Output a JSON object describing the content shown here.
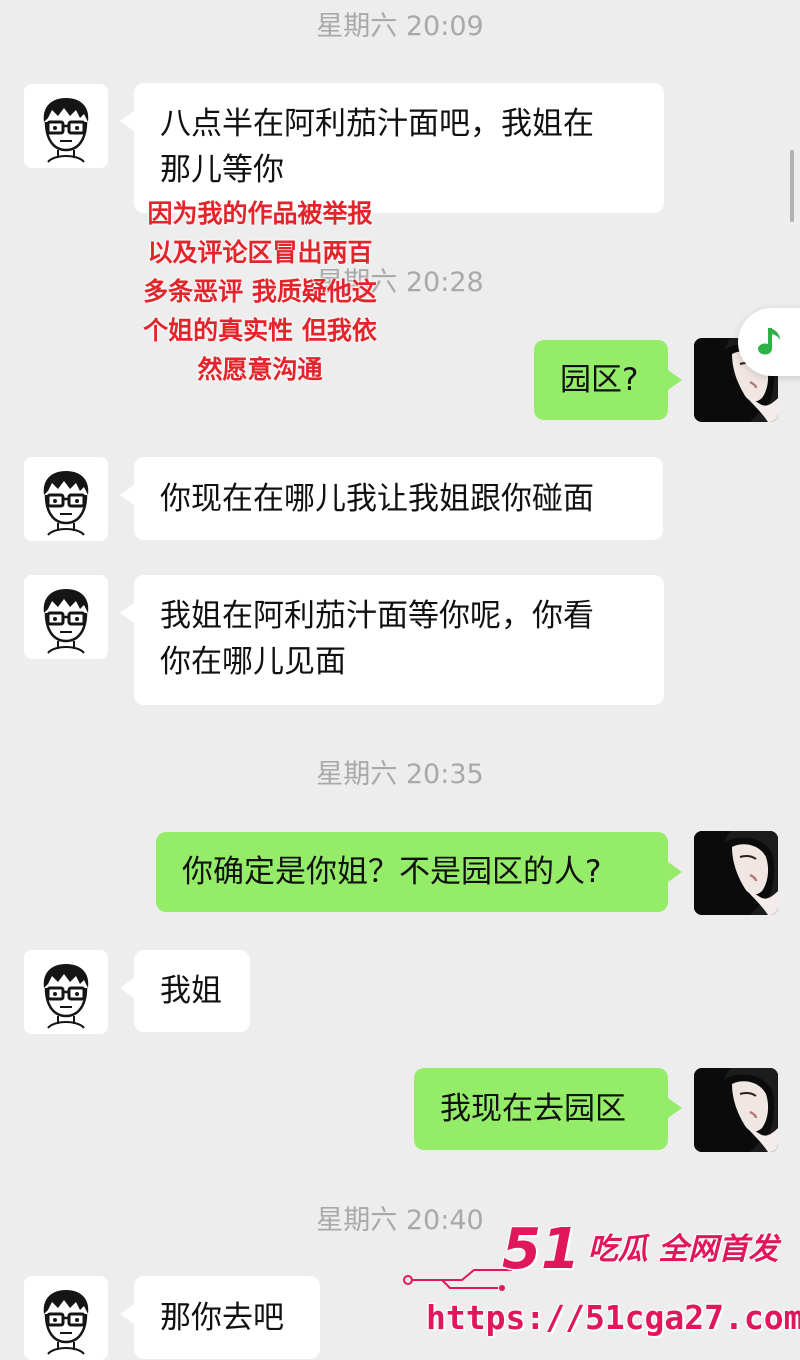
{
  "conversation": [
    {
      "type": "time",
      "text": "星期六 20:09"
    },
    {
      "type": "message",
      "side": "left",
      "lines": [
        "八点半在阿利茄汁面吧，我姐在",
        "那儿等你"
      ]
    },
    {
      "type": "time",
      "text": "星期六 20:28"
    },
    {
      "type": "message",
      "side": "right",
      "lines": [
        "园区?"
      ]
    },
    {
      "type": "message",
      "side": "left",
      "lines": [
        "你现在在哪儿我让我姐跟你碰面"
      ]
    },
    {
      "type": "message",
      "side": "left",
      "lines": [
        "我姐在阿利茄汁面等你呢，你看",
        "你在哪儿见面"
      ]
    },
    {
      "type": "time",
      "text": "星期六 20:35"
    },
    {
      "type": "message",
      "side": "right",
      "lines": [
        "你确定是你姐？不是园区的人?"
      ]
    },
    {
      "type": "message",
      "side": "left",
      "lines": [
        "我姐"
      ]
    },
    {
      "type": "message",
      "side": "right",
      "lines": [
        "我现在去园区"
      ]
    },
    {
      "type": "time",
      "text": "星期六 20:40"
    },
    {
      "type": "message",
      "side": "left",
      "lines": [
        "那你去吧"
      ]
    }
  ],
  "annotation": {
    "lines": [
      "因为我的作品被举报",
      "以及评论区冒出两百",
      "多条恶评 我质疑他这",
      "个姐的真实性 但我依",
      "然愿意沟通"
    ],
    "color": "#e3242b"
  },
  "watermark": {
    "brand_number": "51",
    "brand_text": "吃瓜 全网首发",
    "url": "https://51cga27.com",
    "color": "#e0175a"
  },
  "icons": {
    "self_avatar": "cartoon-boy-glasses-avatar",
    "other_avatar": "woman-portrait-avatar",
    "floating": "music-note-icon"
  },
  "colors": {
    "background": "#ededed",
    "bubble_incoming": "#ffffff",
    "bubble_outgoing": "#95ec69",
    "timestamp": "#a9a9a9"
  }
}
